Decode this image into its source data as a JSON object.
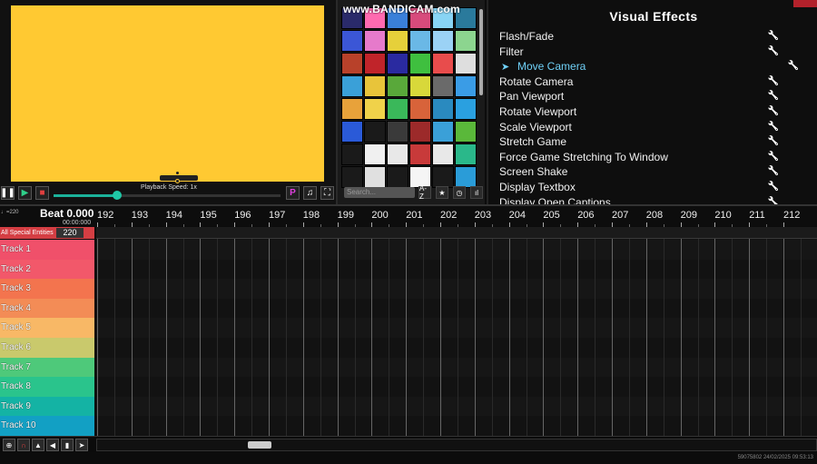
{
  "preview": {
    "playback_speed": "Playback Speed: 1x",
    "speed_value": 0.28,
    "buttons": [
      "pause",
      "play",
      "stop"
    ],
    "right_buttons": [
      "P"
    ]
  },
  "icon_grid": {
    "watermark": "www.BANDICAM.com",
    "search_placeholder": "Search...",
    "sort_label": "A-Z",
    "cell_colors": [
      "#2a2a6a",
      "#ff6ab0",
      "#3a80d9",
      "#d84b7c",
      "#88d4f5",
      "#2a7a9c",
      "#3b56d6",
      "#e67acb",
      "#e6d03a",
      "#6ab8e6",
      "#9bd2f5",
      "#8cd58f",
      "#b8412a",
      "#c0242a",
      "#2a2aa0",
      "#3fbf3f",
      "#e84c4c",
      "#dedede",
      "#3aa0d8",
      "#e8c43a",
      "#59a83a",
      "#d8d83a",
      "#6a6a6a",
      "#3a9ce6",
      "#e8a23a",
      "#f0d24a",
      "#3ab85a",
      "#d8633a",
      "#2a8abf",
      "#2aa0e0",
      "#2a5ad8",
      "#1a1a1a",
      "#3a3a3a",
      "#9c2a2a",
      "#3aa0d8",
      "#5ab83a",
      "#1a1a1a",
      "#f0f0f0",
      "#e8e8e8",
      "#c83a3a",
      "#e8e8e8",
      "#2ab88a",
      "#1a1a1a",
      "#e0e0e0",
      "#1a1a1a",
      "#f5f5f5",
      "#1a1a1a",
      "#2a9cd8"
    ]
  },
  "effects": {
    "title": "Visual Effects",
    "items": [
      {
        "label": "Flash/Fade"
      },
      {
        "label": "Filter"
      },
      {
        "label": "Move Camera",
        "selected": true
      },
      {
        "label": "Rotate Camera"
      },
      {
        "label": "Pan Viewport"
      },
      {
        "label": "Rotate Viewport"
      },
      {
        "label": "Scale Viewport"
      },
      {
        "label": "Stretch Game"
      },
      {
        "label": "Force Game Stretching To Window"
      },
      {
        "label": "Screen Shake"
      },
      {
        "label": "Display Textbox"
      },
      {
        "label": "Display Open Captions"
      }
    ]
  },
  "timeline": {
    "bpm_small": "♩=220",
    "beat": "Beat 0.000",
    "time": "00:00:000",
    "ruler": [
      "192",
      "193",
      "194",
      "195",
      "196",
      "197",
      "198",
      "199",
      "200",
      "201",
      "202",
      "203",
      "204",
      "205",
      "206",
      "207",
      "208",
      "209",
      "210",
      "211",
      "212"
    ],
    "special_label": "All Special Entities",
    "special_bpm": "220",
    "tracks": [
      {
        "label": "Track 1",
        "color": "#f0506a"
      },
      {
        "label": "Track 2",
        "color": "#f2586a"
      },
      {
        "label": "Track 3",
        "color": "#f3744e"
      },
      {
        "label": "Track 4",
        "color": "#f38c56"
      },
      {
        "label": "Track 5",
        "color": "#f8b866"
      },
      {
        "label": "Track 6",
        "color": "#c9c96c"
      },
      {
        "label": "Track 7",
        "color": "#4ec97a"
      },
      {
        "label": "Track 8",
        "color": "#2ac48c"
      },
      {
        "label": "Track 9",
        "color": "#14b3a4"
      },
      {
        "label": "Track 10",
        "color": "#12a0c4"
      }
    ]
  },
  "status": "59075802 24/02/2025 09:53:13"
}
